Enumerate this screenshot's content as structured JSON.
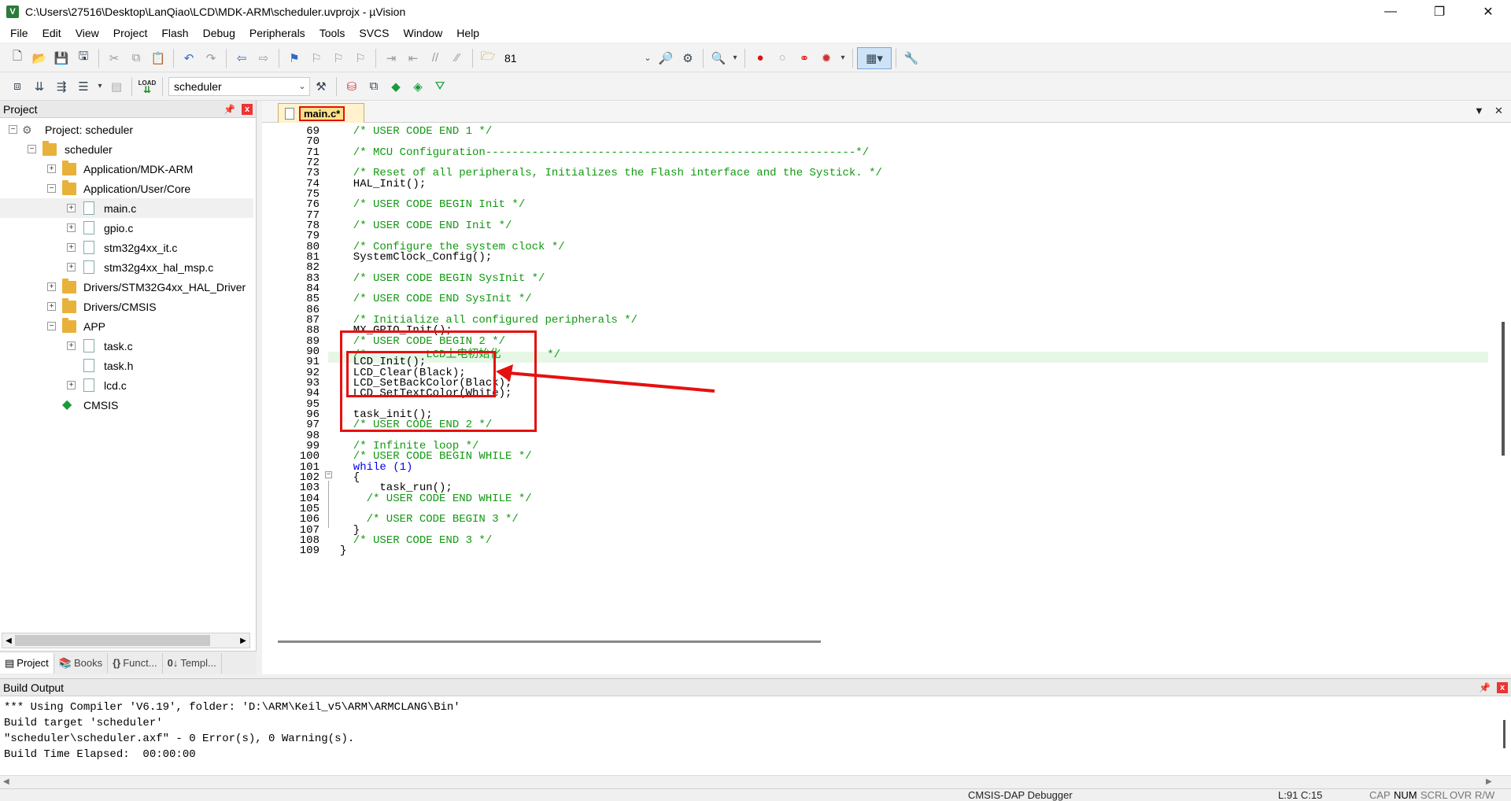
{
  "window": {
    "title": "C:\\Users\\27516\\Desktop\\LanQiao\\LCD\\MDK-ARM\\scheduler.uvprojx - µVision",
    "app_icon": "V",
    "controls": [
      "—",
      "❐",
      "✕"
    ]
  },
  "menu": [
    "File",
    "Edit",
    "View",
    "Project",
    "Flash",
    "Debug",
    "Peripherals",
    "Tools",
    "SVCS",
    "Window",
    "Help"
  ],
  "toolbar1": {
    "find_value": "81"
  },
  "toolbar2": {
    "target_value": "scheduler",
    "load_label": "LOAD"
  },
  "project_panel": {
    "title": "Project",
    "pin": "📌",
    "close": "x",
    "tree": [
      {
        "label": "Project: scheduler",
        "depth": 0,
        "toggle": "−",
        "icon": "project"
      },
      {
        "label": "scheduler",
        "depth": 1,
        "toggle": "−",
        "icon": "folder-open"
      },
      {
        "label": "Application/MDK-ARM",
        "depth": 2,
        "toggle": "+",
        "icon": "folder"
      },
      {
        "label": "Application/User/Core",
        "depth": 2,
        "toggle": "−",
        "icon": "folder-open"
      },
      {
        "label": "main.c",
        "depth": 3,
        "toggle": "+",
        "icon": "file",
        "selected": true
      },
      {
        "label": "gpio.c",
        "depth": 3,
        "toggle": "+",
        "icon": "file"
      },
      {
        "label": "stm32g4xx_it.c",
        "depth": 3,
        "toggle": "+",
        "icon": "file"
      },
      {
        "label": "stm32g4xx_hal_msp.c",
        "depth": 3,
        "toggle": "+",
        "icon": "file"
      },
      {
        "label": "Drivers/STM32G4xx_HAL_Driver",
        "depth": 2,
        "toggle": "+",
        "icon": "folder"
      },
      {
        "label": "Drivers/CMSIS",
        "depth": 2,
        "toggle": "+",
        "icon": "folder"
      },
      {
        "label": "APP",
        "depth": 2,
        "toggle": "−",
        "icon": "folder-open"
      },
      {
        "label": "task.c",
        "depth": 3,
        "toggle": "+",
        "icon": "file"
      },
      {
        "label": "task.h",
        "depth": 3,
        "toggle": "",
        "icon": "file"
      },
      {
        "label": "lcd.c",
        "depth": 3,
        "toggle": "+",
        "icon": "file"
      },
      {
        "label": "CMSIS",
        "depth": 2,
        "toggle": "",
        "icon": "cmsis"
      }
    ],
    "tabs": [
      {
        "label": "Project",
        "icon": "▤",
        "active": true
      },
      {
        "label": "Books",
        "icon": "📚"
      },
      {
        "label": "Funct...",
        "icon": "{}"
      },
      {
        "label": "Templ...",
        "icon": "0↓"
      }
    ]
  },
  "editor": {
    "tab_label": "main.c*",
    "lines": [
      {
        "n": "69",
        "t": "  /* USER CODE END 1 */",
        "c": "cm"
      },
      {
        "n": "70",
        "t": "",
        "c": ""
      },
      {
        "n": "71",
        "t": "  /* MCU Configuration--------------------------------------------------------*/",
        "c": "cm"
      },
      {
        "n": "72",
        "t": "",
        "c": ""
      },
      {
        "n": "73",
        "t": "  /* Reset of all peripherals, Initializes the Flash interface and the Systick. */",
        "c": "cm"
      },
      {
        "n": "74",
        "t": "  HAL_Init();",
        "c": ""
      },
      {
        "n": "75",
        "t": "",
        "c": ""
      },
      {
        "n": "76",
        "t": "  /* USER CODE BEGIN Init */",
        "c": "cm"
      },
      {
        "n": "77",
        "t": "",
        "c": ""
      },
      {
        "n": "78",
        "t": "  /* USER CODE END Init */",
        "c": "cm"
      },
      {
        "n": "79",
        "t": "",
        "c": ""
      },
      {
        "n": "80",
        "t": "  /* Configure the system clock */",
        "c": "cm"
      },
      {
        "n": "81",
        "t": "  SystemClock_Config();",
        "c": ""
      },
      {
        "n": "82",
        "t": "",
        "c": ""
      },
      {
        "n": "83",
        "t": "  /* USER CODE BEGIN SysInit */",
        "c": "cm"
      },
      {
        "n": "84",
        "t": "",
        "c": ""
      },
      {
        "n": "85",
        "t": "  /* USER CODE END SysInit */",
        "c": "cm"
      },
      {
        "n": "86",
        "t": "",
        "c": ""
      },
      {
        "n": "87",
        "t": "  /* Initialize all configured peripherals */",
        "c": "cm"
      },
      {
        "n": "88",
        "t": "  MX_GPIO_Init();",
        "c": ""
      },
      {
        "n": "89",
        "t": "  /* USER CODE BEGIN 2 */",
        "c": "cm"
      },
      {
        "n": "90",
        "t": "  /*         LCD上电初始化       */",
        "c": "cm"
      },
      {
        "n": "91",
        "t": "  LCD_Init();",
        "c": ""
      },
      {
        "n": "92",
        "t": "  LCD_Clear(Black);",
        "c": ""
      },
      {
        "n": "93",
        "t": "  LCD_SetBackColor(Black);",
        "c": ""
      },
      {
        "n": "94",
        "t": "  LCD_SetTextColor(White);",
        "c": ""
      },
      {
        "n": "95",
        "t": "",
        "c": ""
      },
      {
        "n": "96",
        "t": "  task_init();",
        "c": ""
      },
      {
        "n": "97",
        "t": "  /* USER CODE END 2 */",
        "c": "cm"
      },
      {
        "n": "98",
        "t": "",
        "c": ""
      },
      {
        "n": "99",
        "t": "  /* Infinite loop */",
        "c": "cm"
      },
      {
        "n": "100",
        "t": "  /* USER CODE BEGIN WHILE */",
        "c": "cm"
      },
      {
        "n": "101",
        "t": "  while (1)",
        "c": "while"
      },
      {
        "n": "102",
        "t": "  {",
        "c": ""
      },
      {
        "n": "103",
        "t": "      task_run();",
        "c": ""
      },
      {
        "n": "104",
        "t": "    /* USER CODE END WHILE */",
        "c": "cm"
      },
      {
        "n": "105",
        "t": "",
        "c": ""
      },
      {
        "n": "106",
        "t": "    /* USER CODE BEGIN 3 */",
        "c": "cm"
      },
      {
        "n": "107",
        "t": "  }",
        "c": ""
      },
      {
        "n": "108",
        "t": "  /* USER CODE END 3 */",
        "c": "cm"
      },
      {
        "n": "109",
        "t": "}",
        "c": ""
      }
    ]
  },
  "build_output": {
    "title": "Build Output",
    "lines": [
      "*** Using Compiler 'V6.19', folder: 'D:\\ARM\\Keil_v5\\ARM\\ARMCLANG\\Bin'",
      "Build target 'scheduler'",
      "\"scheduler\\scheduler.axf\" - 0 Error(s), 0 Warning(s).",
      "Build Time Elapsed:  00:00:00"
    ]
  },
  "status": {
    "debugger": "CMSIS-DAP Debugger",
    "position": "L:91 C:15",
    "indicators": [
      "CAP",
      "NUM",
      "SCRL",
      "OVR",
      "R/W"
    ]
  },
  "colors": {
    "comment": "#119911",
    "keyword": "#0000ee",
    "highlight": "#e51010",
    "current_line": "#e6f7e6"
  }
}
